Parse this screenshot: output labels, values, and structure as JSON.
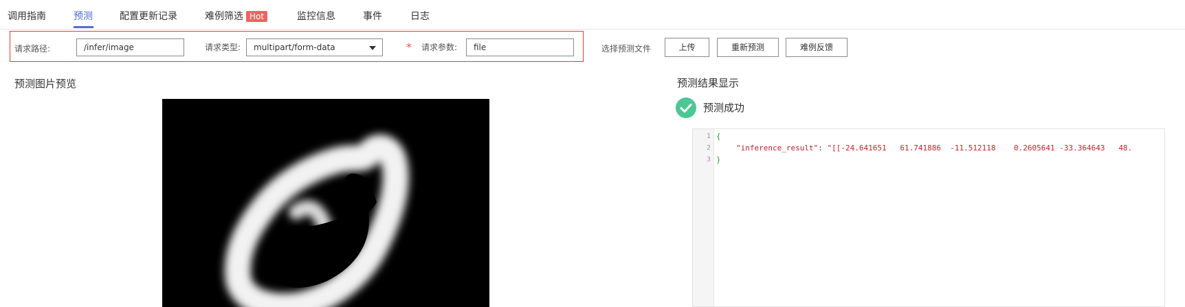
{
  "tabs": [
    {
      "label": "调用指南",
      "active": false
    },
    {
      "label": "预测",
      "active": true
    },
    {
      "label": "配置更新记录",
      "active": false
    },
    {
      "label": "难例筛选",
      "active": false,
      "badge": "Hot"
    },
    {
      "label": "监控信息",
      "active": false
    },
    {
      "label": "事件",
      "active": false
    },
    {
      "label": "日志",
      "active": false
    }
  ],
  "request": {
    "path_label": "请求路径:",
    "path_value": "/infer/image",
    "type_label": "请求类型:",
    "type_value": "multipart/form-data",
    "param_required_mark": "*",
    "param_label": "请求参数:",
    "param_value": "file",
    "file_label": "选择预测文件",
    "upload_button": "上传",
    "repredict_button": "重新预测",
    "feedback_button": "难例反馈"
  },
  "preview": {
    "title": "预测图片预览"
  },
  "result": {
    "title": "预测结果显示",
    "status": "预测成功",
    "code_lines": [
      {
        "num": "1",
        "text": "{"
      },
      {
        "num": "2",
        "key": "\"inference_result\"",
        "sep": ": ",
        "value": "\"[[-24.641651   61.741886  -11.512118    0.2605641 -33.364643   48."
      },
      {
        "num": "3",
        "text": "}"
      }
    ]
  },
  "colors": {
    "accent": "#526ecc",
    "hot_badge": "#f06262",
    "success": "#4cc795",
    "highlight_border": "#e03a3a"
  }
}
